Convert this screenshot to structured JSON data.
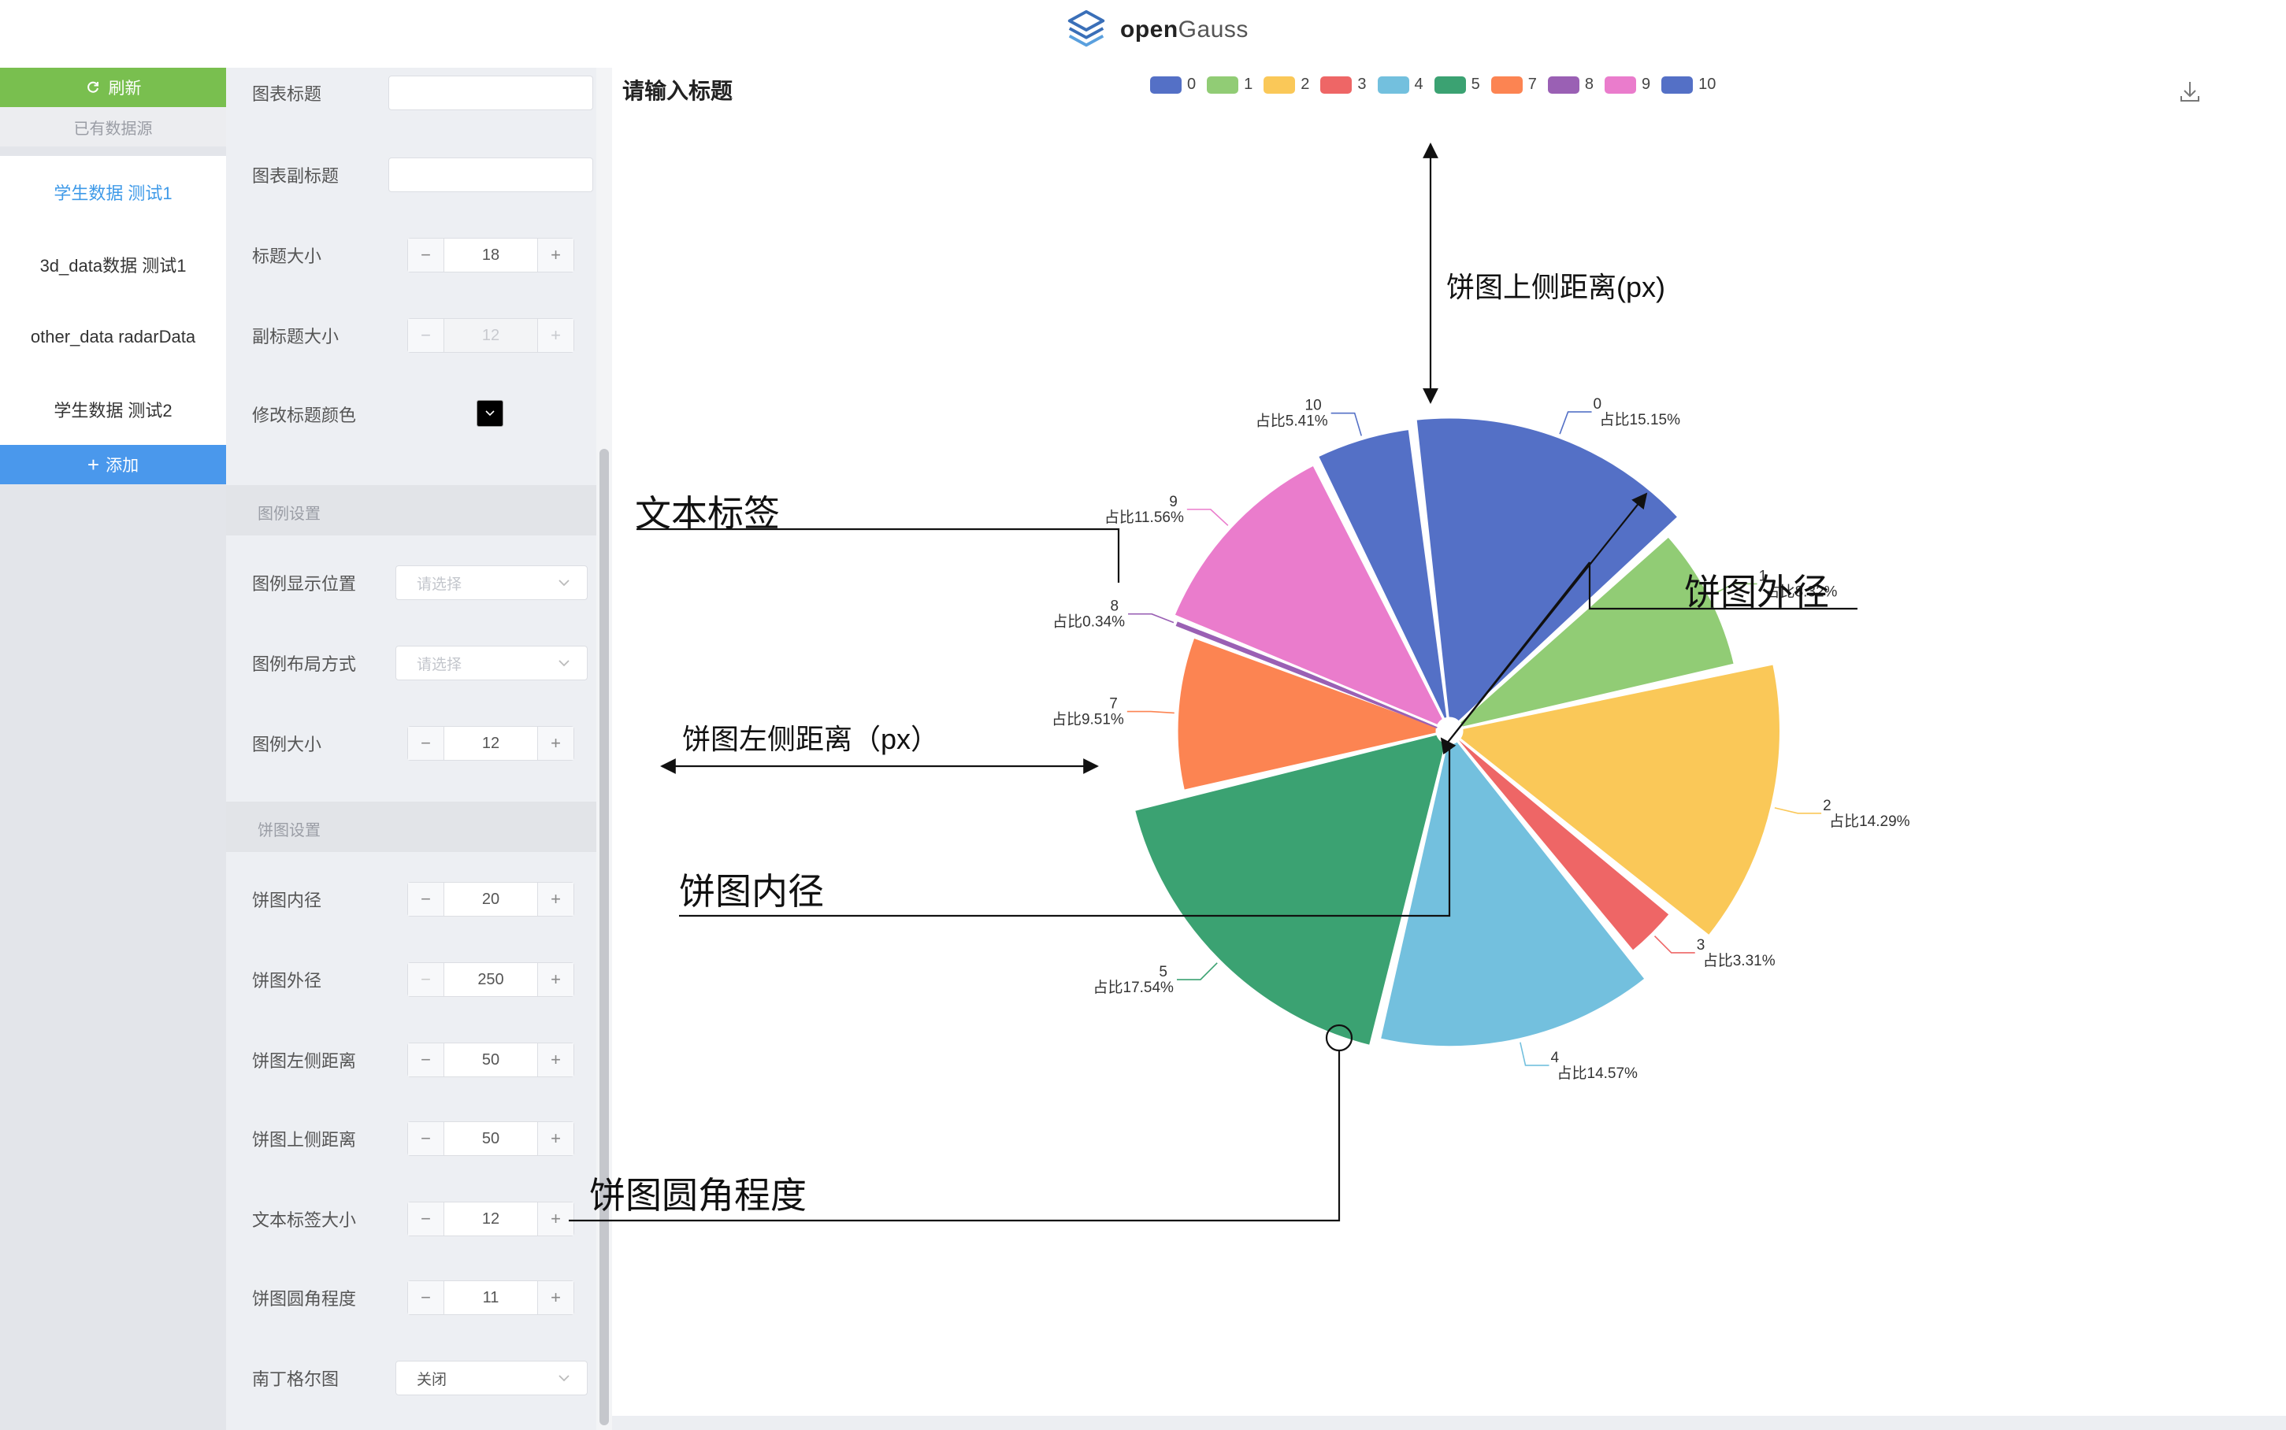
{
  "header": {
    "logo_text_bold": "open",
    "logo_text_thin": "Gauss"
  },
  "sidebar": {
    "refresh_label": "刷新",
    "datasource_heading": "已有数据源",
    "items": [
      {
        "label": "学生数据 测试1",
        "active": true
      },
      {
        "label": "3d_data数据 测试1",
        "active": false
      },
      {
        "label": "other_data radarData",
        "active": false
      },
      {
        "label": "学生数据 测试2",
        "active": false
      }
    ],
    "add_label": "添加"
  },
  "settings": {
    "chart_title_label": "图表标题",
    "chart_title_value": "",
    "chart_subtitle_label": "图表副标题",
    "chart_subtitle_value": "",
    "title_size_label": "标题大小",
    "title_size_value": "18",
    "subtitle_size_label": "副标题大小",
    "subtitle_size_value": "12",
    "title_color_label": "修改标题颜色",
    "legend_section": "图例设置",
    "legend_position_label": "图例显示位置",
    "legend_position_placeholder": "请选择",
    "legend_layout_label": "图例布局方式",
    "legend_layout_placeholder": "请选择",
    "legend_size_label": "图例大小",
    "legend_size_value": "12",
    "pie_section": "饼图设置",
    "inner_radius_label": "饼图内径",
    "inner_radius_value": "20",
    "outer_radius_label": "饼图外径",
    "outer_radius_value": "250",
    "left_distance_label": "饼图左侧距离",
    "left_distance_value": "50",
    "top_distance_label": "饼图上侧距离",
    "top_distance_value": "50",
    "text_label_size_label": "文本标签大小",
    "text_label_size_value": "12",
    "corner_radius_label": "饼图圆角程度",
    "corner_radius_value": "11",
    "nightingale_label": "南丁格尔图",
    "nightingale_value": "关闭"
  },
  "stepper_symbols": {
    "minus": "−",
    "plus": "+"
  },
  "chart_title": "请输入标题",
  "chart_data": {
    "type": "pie",
    "title": "请输入标题",
    "label_prefix": "占比",
    "legend_position": "top-center",
    "categories": [
      "0",
      "1",
      "2",
      "3",
      "4",
      "5",
      "7",
      "8",
      "9",
      "10"
    ],
    "values": [
      15.15,
      8.32,
      14.29,
      3.31,
      14.57,
      17.54,
      9.51,
      0.34,
      11.56,
      5.41
    ],
    "percent_labels": [
      "15.15%",
      "8.32%",
      "14.29%",
      "3.31%",
      "14.57%",
      "17.54%",
      "9.51%",
      "0.34%",
      "11.56%",
      "5.41%"
    ],
    "colors": [
      "#5470c6",
      "#91cc75",
      "#fac858",
      "#ee6666",
      "#73c0de",
      "#3ba272",
      "#fc8452",
      "#9a60b4",
      "#ea7ccc",
      "#5470c6"
    ]
  },
  "annotations": {
    "top_distance": "饼图上侧距离(px)",
    "text_label": "文本标签",
    "outer_radius": "饼图外径",
    "left_distance": "饼图左侧距离（px）",
    "inner_radius": "饼图内径",
    "corner_radius": "饼图圆角程度"
  }
}
